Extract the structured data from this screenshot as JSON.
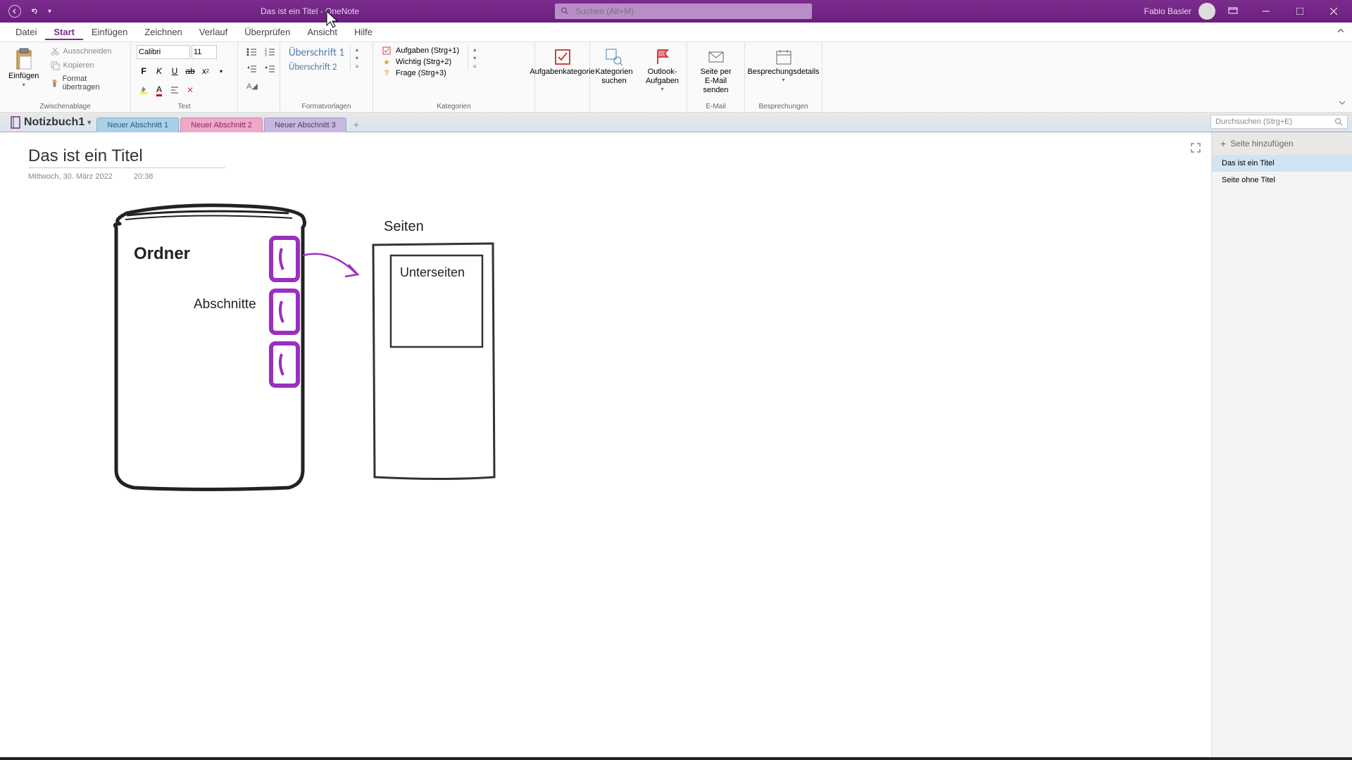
{
  "titlebar": {
    "document_title": "Das ist ein Titel",
    "app_name": "OneNote",
    "full_title": "Das ist ein Titel  -  OneNote",
    "search_placeholder": "Suchen (Alt+M)",
    "user_name": "Fabio Basler"
  },
  "menu": {
    "items": [
      "Datei",
      "Start",
      "Einfügen",
      "Zeichnen",
      "Verlauf",
      "Überprüfen",
      "Ansicht",
      "Hilfe"
    ],
    "active_index": 1
  },
  "ribbon": {
    "clipboard": {
      "group_label": "Zwischenablage",
      "paste": "Einfügen",
      "cut": "Ausschneiden",
      "copy": "Kopieren",
      "format_painter": "Format übertragen"
    },
    "text": {
      "group_label": "Text",
      "font": "Calibri",
      "size": "11"
    },
    "styles": {
      "group_label": "Formatvorlagen",
      "heading1": "Überschrift 1",
      "heading2": "Überschrift 2"
    },
    "tags": {
      "group_label": "Kategorien",
      "task": "Aufgaben (Strg+1)",
      "important": "Wichtig (Strg+2)",
      "question": "Frage (Strg+3)",
      "task_category": "Aufgabenkategorie",
      "find_tags": "Kategorien suchen",
      "outlook_tasks": "Outlook-Aufgaben"
    },
    "email": {
      "group_label": "E-Mail",
      "email_page": "Seite per E-Mail senden"
    },
    "meetings": {
      "group_label": "Besprechungen",
      "meeting_details": "Besprechungsdetails"
    }
  },
  "sections": {
    "notebook": "Notizbuch1",
    "tabs": [
      {
        "label": "Neuer Abschnitt 1",
        "color": "active"
      },
      {
        "label": "Neuer Abschnitt 2",
        "color": "pink"
      },
      {
        "label": "Neuer Abschnitt 3",
        "color": "purple"
      }
    ],
    "search_placeholder": "Durchsuchen (Strg+E)"
  },
  "page_panel": {
    "add_page": "Seite hinzufügen",
    "pages": [
      {
        "title": "Das ist ein Titel",
        "selected": true
      },
      {
        "title": "Seite ohne Titel",
        "selected": false
      }
    ]
  },
  "page": {
    "title": "Das ist ein Titel",
    "date": "Mittwoch, 30. März 2022",
    "time": "20:38"
  },
  "drawing": {
    "folder_label": "Ordner",
    "sections_label": "Abschnitte",
    "pages_label": "Seiten",
    "subpages_label": "Unterseiten"
  },
  "colors": {
    "accent": "#7b2d8e",
    "tab_active": "#a8d0e8",
    "tab_pink": "#f0a8c8",
    "tab_purple": "#c8b8e0",
    "ink_purple": "#9b2fbf"
  }
}
